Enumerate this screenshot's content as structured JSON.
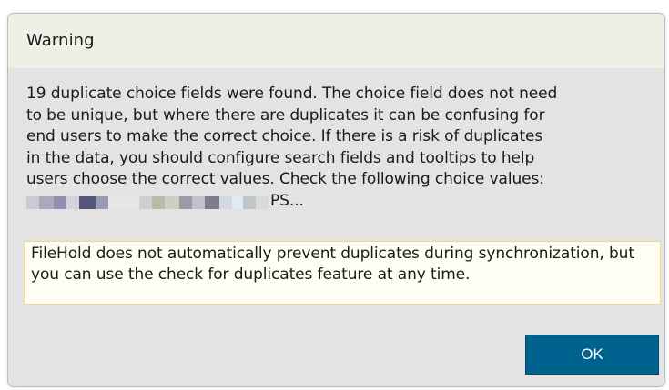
{
  "dialog": {
    "title": "Warning",
    "message_lines": [
      "19 duplicate choice fields were found. The choice field does not need",
      "to be unique, but where there are duplicates it can be confusing for",
      "end users to make the correct choice. If there is a risk of duplicates",
      "in the data, you should configure search fields and tooltips to help",
      "users choose the correct values. Check the following choice values:"
    ],
    "redacted_tail": "PS...",
    "redacted_colors": [
      "#c9cad3",
      "#a9aabc",
      "#8f91ad",
      "#d5d3de",
      "#53557a",
      "#9a9bb3",
      "#e8e6ea",
      "#cfcfcf",
      "#b9baa8",
      "#d2cdc4",
      "#9b9ba7",
      "#c1c1c9",
      "#7c7c8e",
      "#d4d9de",
      "#e1eaee",
      "#bfc6c8",
      "#d9dadf"
    ],
    "note": "FileHold does not automatically prevent duplicates during synchronization, but you can use the check for duplicates feature at any time.",
    "ok_label": "OK",
    "accent_color": "#00628e"
  }
}
